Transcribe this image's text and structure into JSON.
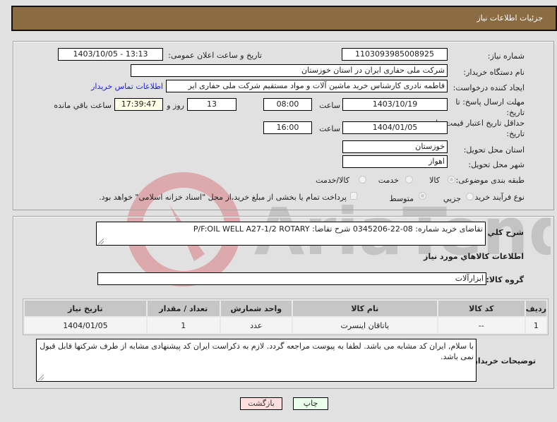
{
  "header": {
    "title": "جزئیات اطلاعات نیاز"
  },
  "form": {
    "need_number": {
      "label": "شماره نیاز:",
      "value": "1103093985008925"
    },
    "announce_datetime": {
      "label": "تاریخ و ساعت اعلان عمومی:",
      "value": "1403/10/05 - 13:13"
    },
    "buyer_org": {
      "label": "نام دستگاه خریدار:",
      "value": "شرکت ملی حفاری ایران در استان خوزستان"
    },
    "requester": {
      "label": "ایجاد کننده درخواست:",
      "value": "فاطمه نادری کارشناس خرید ماشین آلات و مواد مستقیم شرکت ملی حفاری ایر",
      "contact_link": "اطلاعات تماس خریدار"
    },
    "reply_deadline": {
      "label": "مهلت ارسال پاسخ: تا تاریخ:",
      "date": "1403/10/19",
      "time_label": "ساعت",
      "time": "08:00",
      "days": "13",
      "days_label": "روز و",
      "remaining": "17:39:47",
      "remaining_label": "ساعت باقي مانده"
    },
    "price_validity": {
      "label": "حداقل تاریخ اعتبار قیمت: تا تاریخ:",
      "date": "1404/01/05",
      "time_label": "ساعت",
      "time": "16:00"
    },
    "delivery_province": {
      "label": "استان محل تحویل:",
      "value": "خوزستان"
    },
    "delivery_city": {
      "label": "شهر محل تحویل:",
      "value": "اهواز"
    },
    "category": {
      "label": "طبقه بندی موضوعی:",
      "options": [
        "کالا",
        "خدمت",
        "کالا/خدمت"
      ],
      "selected": "کالا"
    },
    "purchase_type": {
      "label": "نوع فرآیند خرید :",
      "options": [
        "جزیي",
        "متوسط"
      ],
      "selected": "متوسط",
      "treasury_checkbox_label": "پرداخت تمام یا بخشی از مبلغ خرید،از محل \"اسناد خزانه اسلامی\" خواهد بود.",
      "treasury_checked": false
    }
  },
  "description": {
    "label": "شرح كلي نياز:",
    "value": "تقاضای خرید شماره:  08-22-0345206  شرح تقاضا: P/F:OIL WELL A27-1/2 ROTARY"
  },
  "goods_section": {
    "title": "اطلاعات كالاهاي مورد نياز",
    "group_label": "گروه كالا:",
    "group_value": "ابزارآلات",
    "table": {
      "columns": [
        "رديف",
        "كد كالا",
        "نام كالا",
        "واحد شمارش",
        "تعداد / مقدار",
        "تاريخ نياز"
      ],
      "rows": [
        [
          "1",
          "--",
          "یاتاقان اینسرت",
          "عدد",
          "1",
          "1404/01/05"
        ]
      ]
    },
    "buyer_notes_label": "توضيحات خريدار:",
    "buyer_notes": "با سلام, ایران کد مشابه می باشد. لطفا به پیوست مراجعه گردد. لازم به ذکراست ایران کد پیشنهادی مشابه از طرف شرکتها قابل قبول نمی باشد."
  },
  "buttons": {
    "print": "چاپ",
    "back": "بازگشت"
  },
  "colors": {
    "header_bg": "#8b6b42",
    "print_bg": "#eaffea",
    "back_bg": "#ffdede",
    "link": "#1a1aff"
  },
  "watermark": {
    "text": "AriaTender.net"
  }
}
